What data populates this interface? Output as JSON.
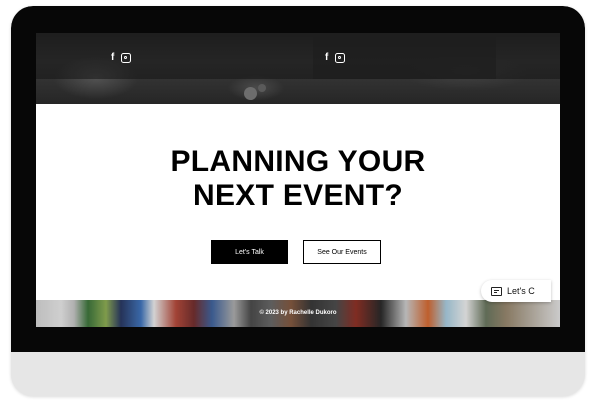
{
  "header": {
    "social_left": {
      "facebook": "f",
      "instagram_icon": "instagram-icon"
    },
    "social_right": {
      "facebook": "f",
      "instagram_icon": "instagram-icon"
    }
  },
  "hero": {
    "headline_line1": "PLANNING YOUR",
    "headline_line2": "NEXT EVENT?",
    "primary_button": "Let's Talk",
    "secondary_button": "See Our Events"
  },
  "footer": {
    "copyright": "© 2023 by Rachelle Dukoro"
  },
  "chat": {
    "label": "Let's C",
    "icon": "chat-icon"
  },
  "colors": {
    "bezel": "#070707",
    "primary_button": "#000000",
    "text": "#000000",
    "chin": "#e6e6e6"
  }
}
